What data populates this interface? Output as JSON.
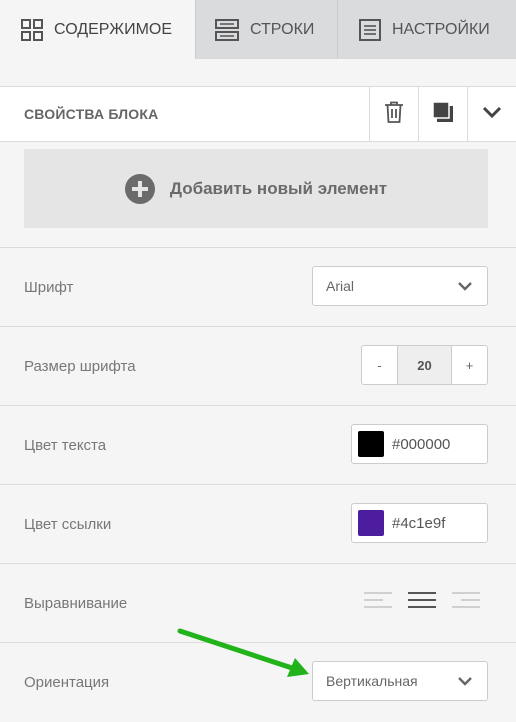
{
  "tabs": [
    {
      "label": "СОДЕРЖИМОЕ",
      "icon": "grid-icon",
      "active": true
    },
    {
      "label": "СТРОКИ",
      "icon": "rows-icon",
      "active": false
    },
    {
      "label": "НАСТРОЙКИ",
      "icon": "settings-list-icon",
      "active": false
    }
  ],
  "panel": {
    "title": "СВОЙСТВА БЛОКА",
    "buttons": [
      "trash-icon",
      "duplicate-icon",
      "chevron-down-icon"
    ]
  },
  "add_element": {
    "label": "Добавить новый элемент",
    "icon": "plus-circle-icon"
  },
  "properties": {
    "font": {
      "label": "Шрифт",
      "value": "Arial"
    },
    "font_size": {
      "label": "Размер шрифта",
      "minus": "-",
      "value": "20",
      "plus": "+"
    },
    "text_color": {
      "label": "Цвет текста",
      "value": "#000000",
      "swatch": "#000000"
    },
    "link_color": {
      "label": "Цвет ссылки",
      "value": "#4c1e9f",
      "swatch": "#4c1e9f"
    },
    "alignment": {
      "label": "Выравнивание",
      "options": [
        "align-left-icon",
        "align-center-icon",
        "align-right-icon"
      ],
      "selected": "align-center-icon"
    },
    "orientation": {
      "label": "Ориентация",
      "value": "Вертикальная"
    }
  },
  "colors": {
    "annotation_arrow": "#22b21a",
    "tab_inactive_bg": "#d9dbdc"
  }
}
